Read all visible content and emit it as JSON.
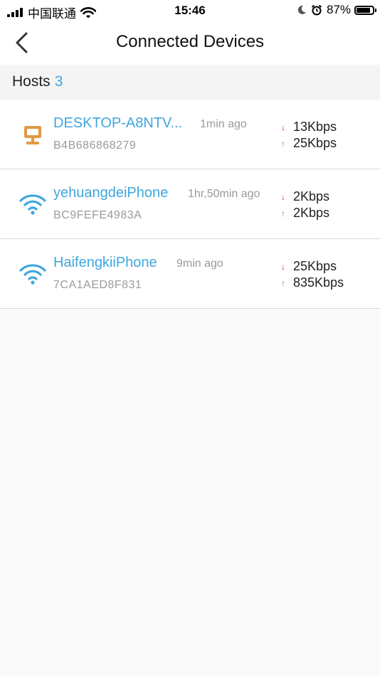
{
  "status_bar": {
    "carrier": "中国联通",
    "time": "15:46",
    "battery": "87%"
  },
  "nav": {
    "title": "Connected Devices"
  },
  "hosts": {
    "label": "Hosts",
    "count": "3"
  },
  "devices": [
    {
      "name": "DESKTOP-A8NTV...",
      "last_seen": "1min ago",
      "mac": "B4B686868279",
      "download": "13Kbps",
      "upload": "25Kbps",
      "type": "computer-icon"
    },
    {
      "name": "yehuangdeiPhone",
      "last_seen": "1hr,50min ago",
      "mac": "BC9FEFE4983A",
      "download": "2Kbps",
      "upload": "2Kbps",
      "type": "wifi-icon"
    },
    {
      "name": "HaifengkiiPhone",
      "last_seen": "9min ago",
      "mac": "7CA1AED8F831",
      "download": "25Kbps",
      "upload": "835Kbps",
      "type": "wifi-icon"
    }
  ],
  "colors": {
    "accent": "#3fa6de",
    "computer_icon": "#e09a45",
    "download_arrow": "#d6322e",
    "upload_arrow": "#3cae3a"
  }
}
